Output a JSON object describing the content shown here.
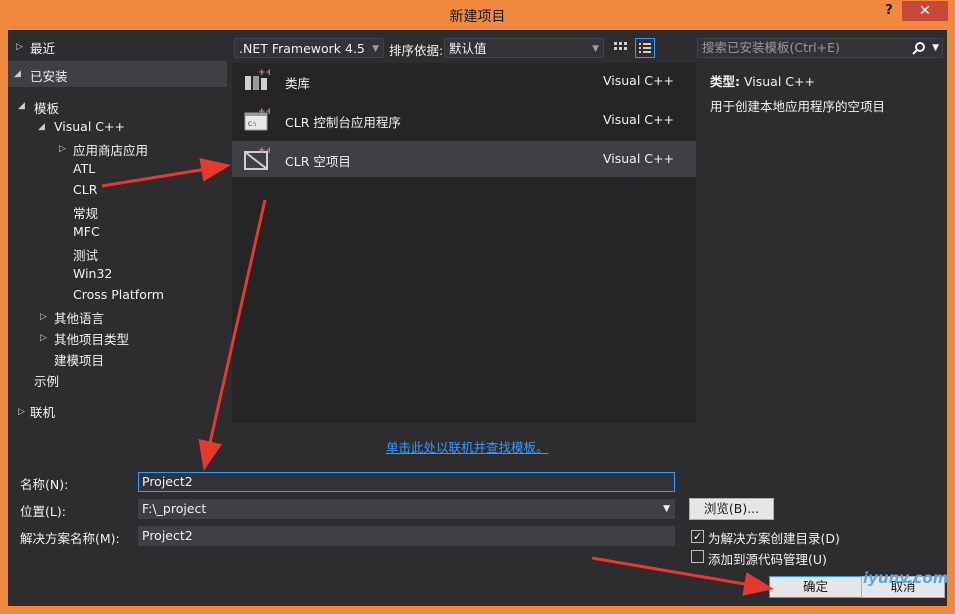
{
  "window": {
    "title": "新建项目",
    "help": "?",
    "close": "✕"
  },
  "tree": {
    "recent": "最近",
    "installed": "已安装",
    "templates": "模板",
    "visual_cpp": "Visual C++",
    "store_apps": "应用商店应用",
    "atl": "ATL",
    "clr": "CLR",
    "general": "常规",
    "mfc": "MFC",
    "test": "测试",
    "win32": "Win32",
    "cross_platform": "Cross Platform",
    "other_languages": "其他语言",
    "other_project_types": "其他项目类型",
    "modeling_projects": "建模项目",
    "samples": "示例",
    "online": "联机"
  },
  "toolbar": {
    "framework": ".NET Framework 4.5",
    "sort_label": "排序依据:",
    "sort_value": "默认值",
    "search_placeholder": "搜索已安装模板(Ctrl+E)"
  },
  "templates": [
    {
      "name": "类库",
      "lang": "Visual C++"
    },
    {
      "name": "CLR 控制台应用程序",
      "lang": "Visual C++"
    },
    {
      "name": "CLR 空项目",
      "lang": "Visual C++"
    }
  ],
  "details": {
    "type_label": "类型:",
    "type_value": "Visual C++",
    "description": "用于创建本地应用程序的空项目"
  },
  "online_link": "单击此处以联机并查找模板。",
  "form": {
    "name_label": "名称(N):",
    "name_value": "Project2",
    "location_label": "位置(L):",
    "location_value": "F:\\_project",
    "solution_label": "解决方案名称(M):",
    "solution_value": "Project2",
    "browse": "浏览(B)...",
    "create_dir": "为解决方案创建目录(D)",
    "create_dir_checked": true,
    "add_source_control": "添加到源代码管理(U)",
    "add_source_control_checked": false,
    "ok": "确定",
    "cancel": "取消"
  },
  "watermark": "iyunv.com",
  "colors": {
    "accent": "#3399ff",
    "frame": "#f0883d",
    "background": "#2d2d30",
    "arrow": "#e8382e"
  }
}
